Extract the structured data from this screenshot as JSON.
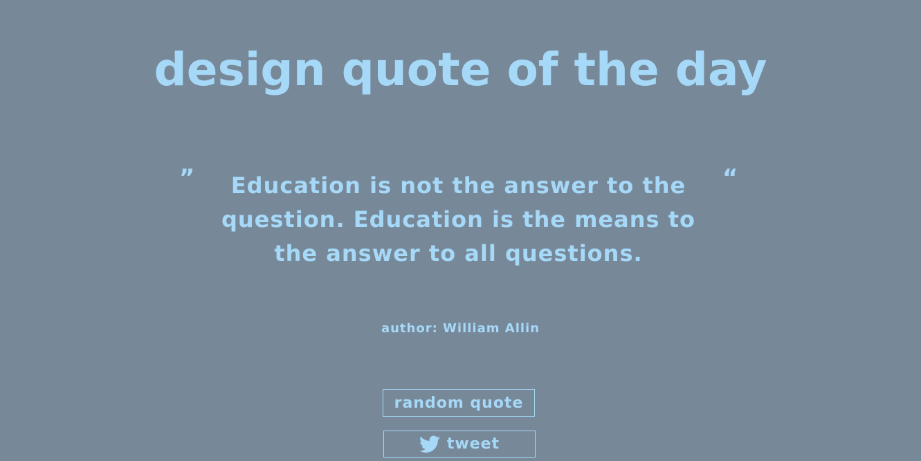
{
  "header": {
    "title": "design quote of the day"
  },
  "quote": {
    "open_mark": "”",
    "close_mark": "“",
    "text": "Education is not the answer to the question. Education is the means to the answer to all questions.",
    "author": "author: William Allin"
  },
  "actions": {
    "random_label": "random quote",
    "tweet_label": "tweet",
    "tweet_icon": "twitter-bird-icon"
  },
  "colors": {
    "background": "#778899",
    "accent": "#a6d8f7"
  }
}
